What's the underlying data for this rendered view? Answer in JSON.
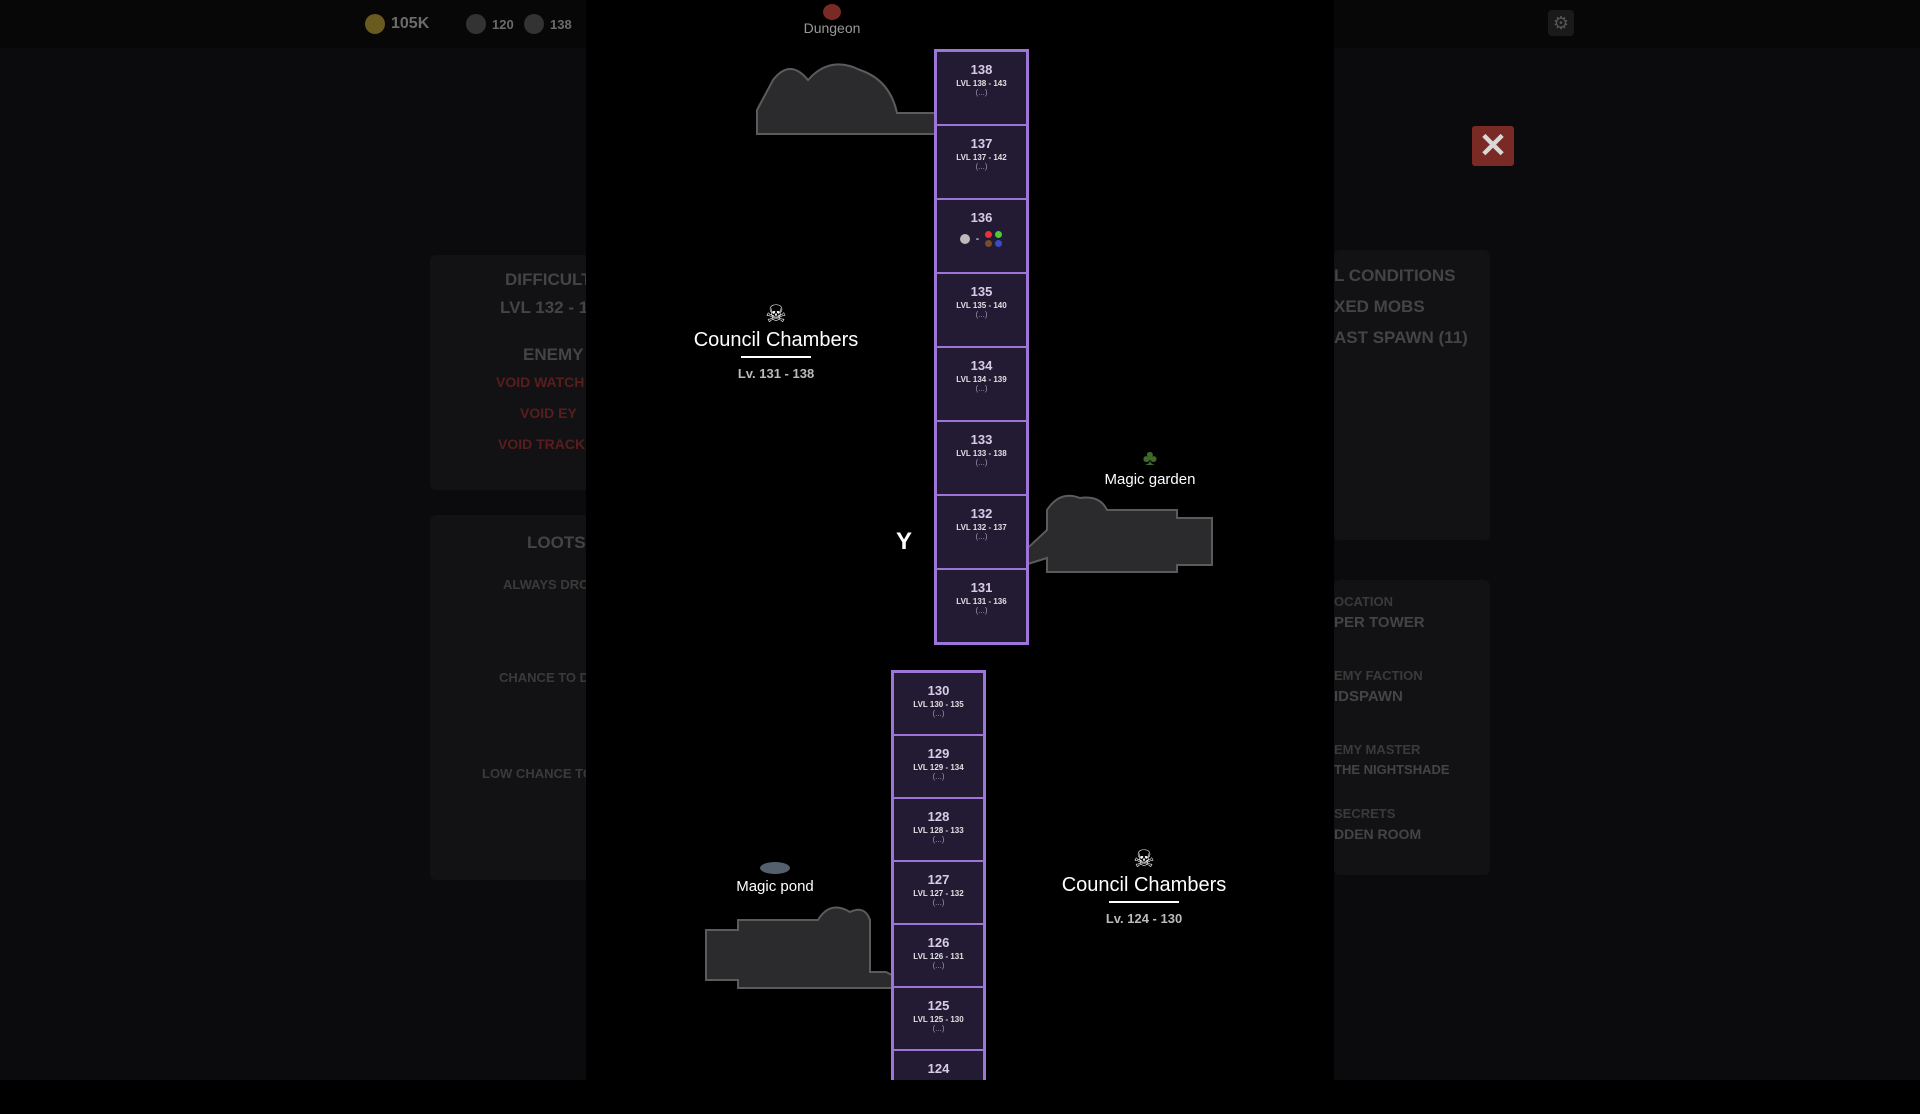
{
  "resources": {
    "gold": "105K",
    "currency2": "120",
    "currency3": "138"
  },
  "background_panel": {
    "difficulty_label": "DIFFICULT",
    "level_range": "LVL 132 - 1",
    "enemy_label": "ENEMY",
    "enemies": [
      "VOID WATCH",
      "VOID EY",
      "VOID TRACK"
    ],
    "loots_label": "LOOTS",
    "always_drop": "ALWAYS DRO",
    "chance_to": "CHANCE TO D",
    "low_chance": "LOW CHANCE TO"
  },
  "right_panel": {
    "conditions_label": "L CONDITIONS",
    "conditions": [
      "XED MOBS",
      "AST SPAWN (11)"
    ],
    "location_label": "OCATION",
    "location": "PER TOWER",
    "faction_label": "EMY FACTION",
    "faction": "IDSPAWN",
    "master_label": "EMY MASTER",
    "master": "THE NIGHTSHADE",
    "secrets_label": "SECRETS",
    "secret": "DDEN ROOM"
  },
  "map": {
    "dungeon_label": "Dungeon",
    "upper_floors": [
      {
        "num": "138",
        "lvl": "LVL 138 - 143",
        "more": "(...)"
      },
      {
        "num": "137",
        "lvl": "LVL 137 - 142",
        "more": "(...)"
      },
      {
        "num": "136",
        "special": true
      },
      {
        "num": "135",
        "lvl": "LVL 135 - 140",
        "more": "(...)"
      },
      {
        "num": "134",
        "lvl": "LVL 134 - 139",
        "more": "(...)"
      },
      {
        "num": "133",
        "lvl": "LVL 133 - 138",
        "more": "(...)"
      },
      {
        "num": "132",
        "lvl": "LVL 132 - 137",
        "more": "(...)"
      },
      {
        "num": "131",
        "lvl": "LVL 131 - 136",
        "more": "(...)"
      }
    ],
    "lower_floors": [
      {
        "num": "130",
        "lvl": "LVL 130 - 135",
        "more": "(...)"
      },
      {
        "num": "129",
        "lvl": "LVL 129 - 134",
        "more": "(...)"
      },
      {
        "num": "128",
        "lvl": "LVL 128 - 133",
        "more": "(...)"
      },
      {
        "num": "127",
        "lvl": "LVL 127 - 132",
        "more": "(...)"
      },
      {
        "num": "126",
        "lvl": "LVL 126 - 131",
        "more": "(...)"
      },
      {
        "num": "125",
        "lvl": "LVL 125 - 130",
        "more": "(...)"
      },
      {
        "num": "124",
        "lvl": "",
        "more": ""
      }
    ],
    "council_upper": {
      "title": "Council Chambers",
      "range": "Lv. 131 - 138"
    },
    "council_lower": {
      "title": "Council Chambers",
      "range": "Lv. 124 - 130"
    },
    "magic_garden": "Magic garden",
    "magic_pond": "Magic pond",
    "floor136_dash": "-"
  },
  "colors": {
    "tower_border": "#9d75d6",
    "tower_fill": "#231a33",
    "room_fill": "#2b2b2d",
    "room_border": "#5b5b5b",
    "close_button": "#7a2a25"
  },
  "icons": {
    "close": "close-icon",
    "settings": "gear-icon",
    "council": "demon-skull-icon",
    "garden": "plant-icon",
    "pond": "fish-icon",
    "dungeon": "dungeon-icon",
    "player_marker": "crossroad-marker-icon"
  }
}
